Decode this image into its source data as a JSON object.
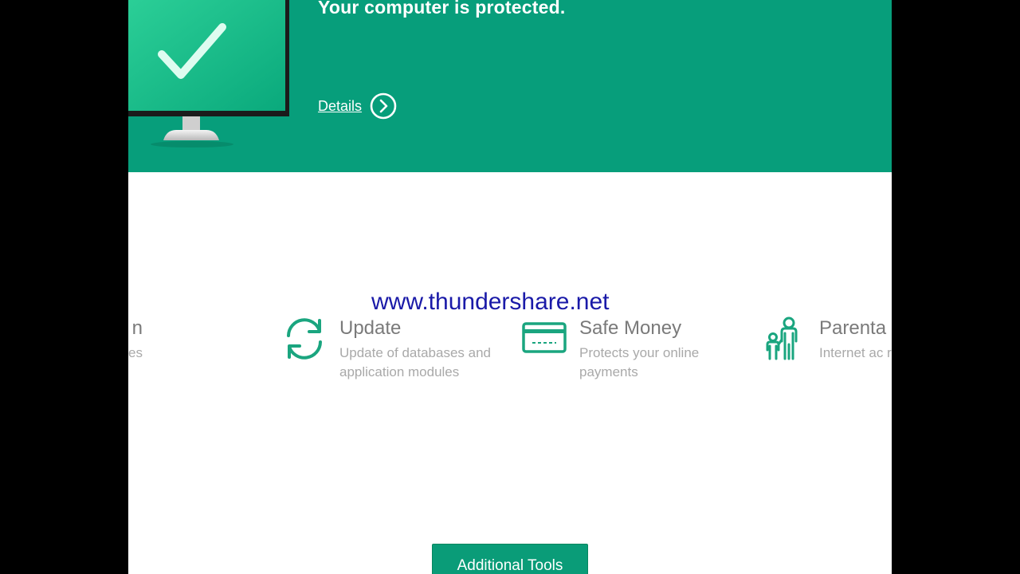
{
  "header": {
    "status_title": "Your computer is protected.",
    "details_label": "Details",
    "background_color": "#079e7b",
    "monitor_icon": "check-monitor-icon",
    "details_icon": "chevron-right-circle-icon"
  },
  "features": {
    "scan": {
      "title": "n",
      "description": "s your computer external devices",
      "icon": "scan-icon"
    },
    "update": {
      "title": "Update",
      "description": "Update of databases and application modules",
      "icon": "refresh-icon"
    },
    "safe_money": {
      "title": "Safe Money",
      "description": "Protects your online payments",
      "icon": "credit-card-icon"
    },
    "parental": {
      "title": "Parenta",
      "description": "Internet ac restriction",
      "icon": "family-icon"
    }
  },
  "watermark": "www.thundershare.net",
  "additional_tools_label": "Additional Tools",
  "colors": {
    "accent": "#079e7b",
    "icon_green": "#1aa57f",
    "watermark": "#1a1aa8",
    "letterbox": "#000000"
  }
}
